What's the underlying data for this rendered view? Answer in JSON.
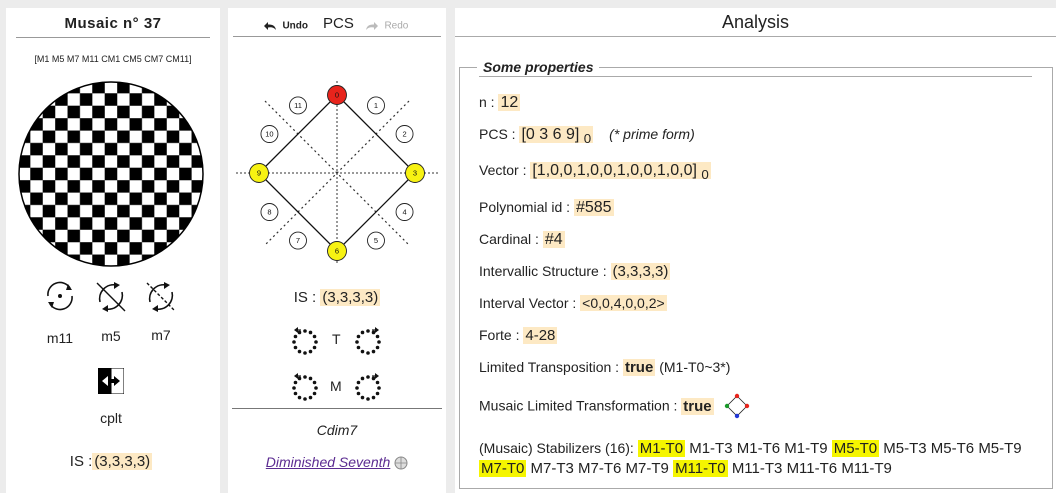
{
  "musaic": {
    "title": "Musaic n° 37",
    "group_label": "[M1 M5 M7 M11 CM1 CM5 CM7 CM11]",
    "ops": [
      {
        "label": "m11",
        "icon": "rotate-point-icon"
      },
      {
        "label": "m5",
        "icon": "cross-arrows-icon"
      },
      {
        "label": "m7",
        "icon": "cross-arrows-dashed-icon"
      }
    ],
    "cplt_label": "cplt",
    "is_label": "IS :",
    "is_value": "(3,3,3,3)"
  },
  "pcs": {
    "undo_label": "Undo",
    "title": "PCS",
    "redo_label": "Redo",
    "clock_numbers": [
      "0",
      "1",
      "2",
      "3",
      "4",
      "5",
      "6",
      "7",
      "8",
      "9",
      "10",
      "11"
    ],
    "selected_pcs": [
      0,
      3,
      6,
      9
    ],
    "is_label": "IS : ",
    "is_value": "(3,3,3,3)",
    "t_label": "T",
    "m_label": "M",
    "chord_name": "Cdim7",
    "chord_link": "Diminished Seventh",
    "colors": {
      "zero": "#e8241c",
      "selected": "#f7f212"
    }
  },
  "analysis": {
    "title": "Analysis",
    "section_title": "Some properties",
    "n_label": "n : ",
    "n_value": "12",
    "pcs_label": "PCS : ",
    "pcs_value": "[0 3 6 9]",
    "pcs_sub": "0",
    "prime_form": "(* prime form)",
    "vector_label": "Vector : ",
    "vector_value": "[1,0,0,1,0,0,1,0,0,1,0,0]",
    "vector_sub": "0",
    "poly_label": "Polynomial id : ",
    "poly_value": "#585",
    "cardinal_label": "Cardinal : ",
    "cardinal_value": "#4",
    "is_label": "Intervallic Structure : ",
    "is_value": "(3,3,3,3)",
    "iv_label": "Interval Vector : ",
    "iv_value": "<0,0,4,0,0,2>",
    "forte_label": "Forte : ",
    "forte_value": "4-28",
    "lt_label": "Limited Transposition : ",
    "lt_value": "true",
    "lt_note": " (M1-T0~3*)",
    "mlt_label": "Musaic Limited Transformation : ",
    "mlt_value": "true",
    "stab_label": "(Musaic) Stabilizers (16): ",
    "stabilizers": [
      {
        "t": "M1-T0",
        "h": true
      },
      {
        "t": "M1-T3",
        "h": false
      },
      {
        "t": "M1-T6",
        "h": false
      },
      {
        "t": "M1-T9",
        "h": false
      },
      {
        "t": "M5-T0",
        "h": true
      },
      {
        "t": "M5-T3",
        "h": false
      },
      {
        "t": "M5-T6",
        "h": false
      },
      {
        "t": "M5-T9",
        "h": false
      },
      {
        "t": "M7-T0",
        "h": true
      },
      {
        "t": "M7-T3",
        "h": false
      },
      {
        "t": "M7-T6",
        "h": false
      },
      {
        "t": "M7-T9",
        "h": false
      },
      {
        "t": "M11-T0",
        "h": true
      },
      {
        "t": "M11-T3",
        "h": false
      },
      {
        "t": "M11-T6",
        "h": false
      },
      {
        "t": "M11-T9",
        "h": false
      }
    ]
  }
}
